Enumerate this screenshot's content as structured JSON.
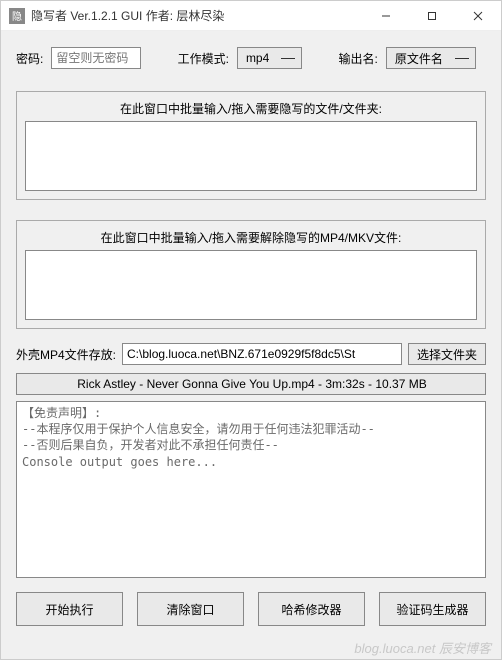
{
  "window": {
    "title": "隐写者 Ver.1.2.1 GUI 作者: 层林尽染"
  },
  "top": {
    "password_label": "密码:",
    "password_placeholder": "留空则无密码",
    "mode_label": "工作模式:",
    "mode_value": "mp4",
    "output_label": "输出名:",
    "output_value": "原文件名"
  },
  "group1": {
    "caption": "在此窗口中批量输入/拖入需要隐写的文件/文件夹:"
  },
  "group2": {
    "caption": "在此窗口中批量输入/拖入需要解除隐写的MP4/MKV文件:"
  },
  "path": {
    "label": "外壳MP4文件存放:",
    "value": "C:\\blog.luoca.net\\BNZ.671e0929f5f8dc5\\St",
    "browse": "选择文件夹"
  },
  "filecombo": {
    "text": "Rick Astley - Never Gonna Give You Up.mp4 - 3m:32s - 10.37 MB"
  },
  "console_text": "【免责声明】:\n--本程序仅用于保护个人信息安全，请勿用于任何违法犯罪活动--\n--否则后果自负，开发者对此不承担任何责任--\nConsole output goes here...",
  "buttons": {
    "start": "开始执行",
    "clear": "清除窗口",
    "hash": "哈希修改器",
    "verify": "验证码生成器"
  },
  "watermark": "blog.luoca.net 辰安博客"
}
